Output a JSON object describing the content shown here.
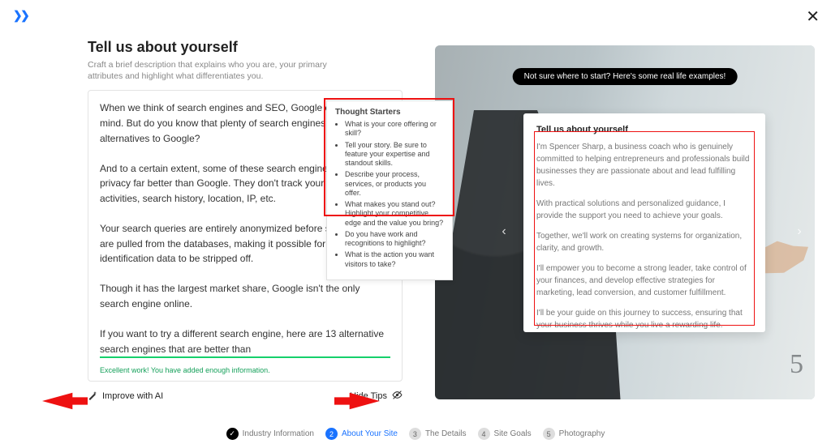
{
  "header": {
    "logo_label": "K"
  },
  "left": {
    "heading": "Tell us about yourself",
    "subhead": "Craft a brief description that explains who you are, your primary attributes and highlight what differentiates you.",
    "editor_value": "When we think of search engines and SEO, Google comes to mind. But do you know that plenty of search engines are alternatives to Google?\n\nAnd to a certain extent, some of these search engines protect your privacy far better than Google. They don't track your online activities, search history, location, IP, etc.\n\nYour search queries are entirely anonymized before search results are pulled from the databases, making it possible for all user identification data to be stripped off.\n\nThough it has the largest market share, Google isn't the only search engine online.\n\nIf you want to try a different search engine, here are 13 alternative search engines that are better than",
    "status_text": "Excellent work! You have added enough information.",
    "improve_label": "Improve with AI",
    "hide_tips_label": "Hide Tips"
  },
  "tips": {
    "title": "Thought Starters",
    "items": [
      "What is your core offering or skill?",
      "Tell your story. Be sure to feature your expertise and standout skills.",
      "Describe your process, services, or products you offer.",
      "What makes you stand out? Highlight your competitive edge and the value you bring?",
      "Do you have work and recognitions to highlight?",
      "What is the action you want visitors to take?"
    ]
  },
  "preview": {
    "hint_pill": "Not sure where to start? Here's some real life examples!",
    "board_num": "5",
    "example": {
      "title": "Tell us about yourself",
      "paragraphs": [
        "I'm Spencer Sharp, a business coach who is genuinely committed to helping entrepreneurs and professionals build businesses they are passionate about and lead fulfilling lives.",
        "With practical solutions and personalized guidance, I provide the support you need to achieve your goals.",
        "Together, we'll work on creating systems for organization, clarity, and growth.",
        "I'll empower you to become a strong leader, take control of your finances, and develop effective strategies for marketing, lead conversion, and customer fulfillment.",
        "I'll be your guide on this journey to success, ensuring that your business thrives while you live a rewarding life."
      ]
    }
  },
  "steps": [
    {
      "num": "✓",
      "label": "Industry Information",
      "state": "done"
    },
    {
      "num": "2",
      "label": "About Your Site",
      "state": "active"
    },
    {
      "num": "3",
      "label": "The Details",
      "state": ""
    },
    {
      "num": "4",
      "label": "Site Goals",
      "state": ""
    },
    {
      "num": "5",
      "label": "Photography",
      "state": ""
    }
  ]
}
